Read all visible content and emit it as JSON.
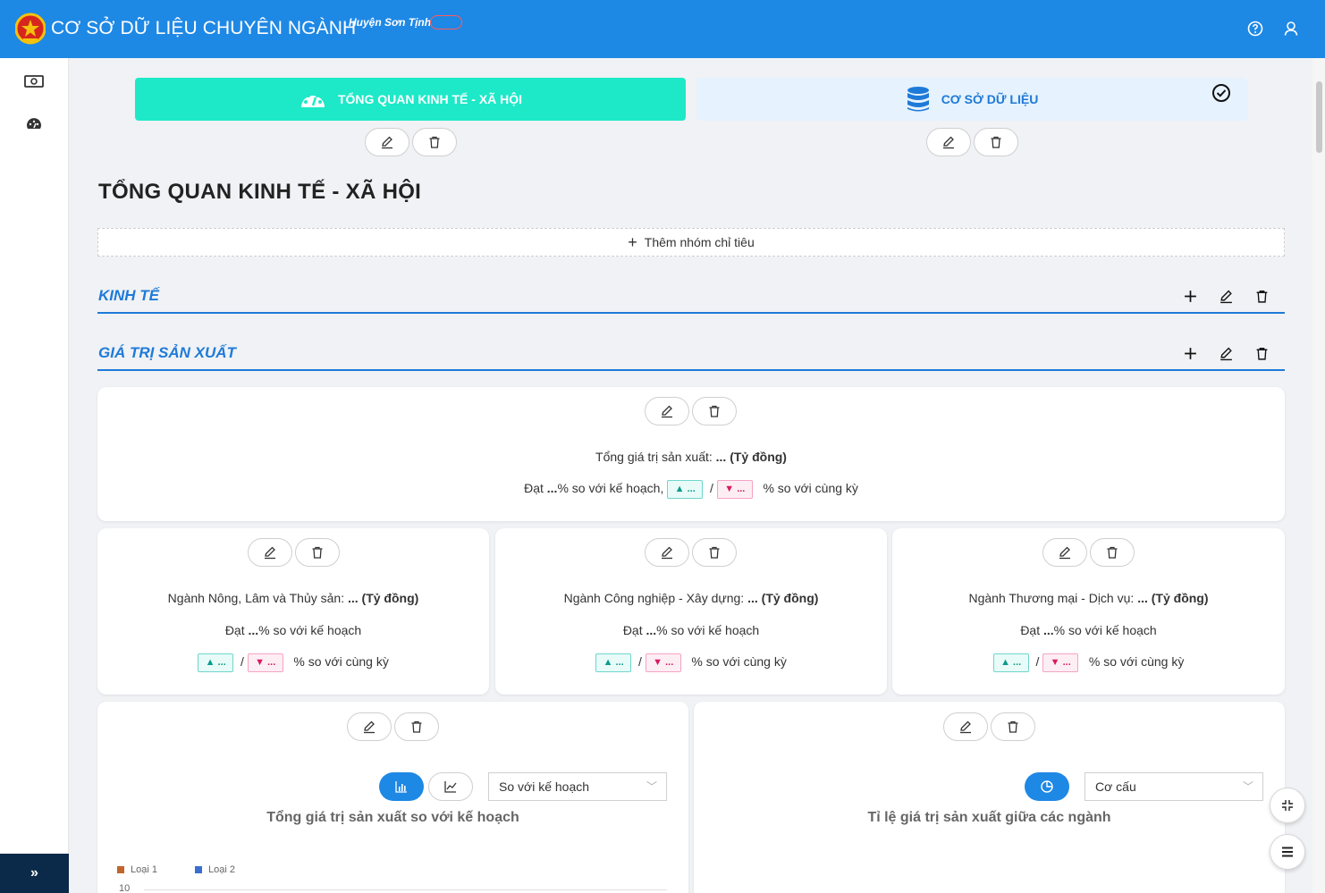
{
  "header": {
    "app_title": "CƠ SỞ DỮ LIỆU CHUYÊN NGÀNH",
    "district": "Huyện Sơn Tịnh",
    "badge": "",
    "brand_color": "#1e88e5"
  },
  "tabs": [
    {
      "label": "TỔNG QUAN KINH TẾ - XÃ HỘI",
      "icon": "dashboard-icon",
      "active": true
    },
    {
      "label": "CƠ SỞ DỮ LIỆU",
      "icon": "database-icon",
      "active": false
    }
  ],
  "page_title": "TỔNG QUAN KINH TẾ - XÃ HỘI",
  "add_group_label": "Thêm nhóm chỉ tiêu",
  "sections": [
    {
      "label": "KINH TẾ"
    },
    {
      "label": "GIÁ TRỊ SẢN XUẤT"
    }
  ],
  "summary_card": {
    "line1_prefix": "Tổng giá trị sản xuất: ",
    "line1_value": "... (Tỷ đồng)",
    "line2_prefix": "Đạt ",
    "line2_value": "...",
    "line2_suffix": "% so với kế hoạch,",
    "up": "...",
    "down": "...",
    "sep": "/",
    "yoy": "% so với cùng kỳ"
  },
  "sector_cards": [
    {
      "name": "Ngành Nông, Lâm và Thủy sản: ",
      "value": "... (Tỷ đồng)",
      "plan_prefix": "Đạt ",
      "plan_value": "...",
      "plan_suffix": "% so với kế hoạch",
      "up": "...",
      "down": "...",
      "sep": "/",
      "yoy": "% so với cùng kỳ"
    },
    {
      "name": "Ngành Công nghiệp - Xây dựng: ",
      "value": "... (Tỷ đồng)",
      "plan_prefix": "Đạt ",
      "plan_value": "...",
      "plan_suffix": "% so với kế hoạch",
      "up": "...",
      "down": "...",
      "sep": "/",
      "yoy": "% so với cùng kỳ"
    },
    {
      "name": "Ngành Thương mại - Dịch vụ: ",
      "value": "... (Tỷ đồng)",
      "plan_prefix": "Đạt ",
      "plan_value": "...",
      "plan_suffix": "% so với kế hoạch",
      "up": "...",
      "down": "...",
      "sep": "/",
      "yoy": "% so với cùng kỳ"
    }
  ],
  "chart_cards": [
    {
      "select_value": "So với kế hoạch",
      "title": "Tổng giá trị sản xuất so với kế hoạch",
      "legend": [
        {
          "name": "Loại 1",
          "color": "#c0662b"
        },
        {
          "name": "Loại 2",
          "color": "#3a6fd0"
        }
      ],
      "y_first_tick": "10"
    },
    {
      "select_value": "Cơ cấu",
      "title": "Tỉ lệ giá trị sản xuất giữa các ngành"
    }
  ]
}
